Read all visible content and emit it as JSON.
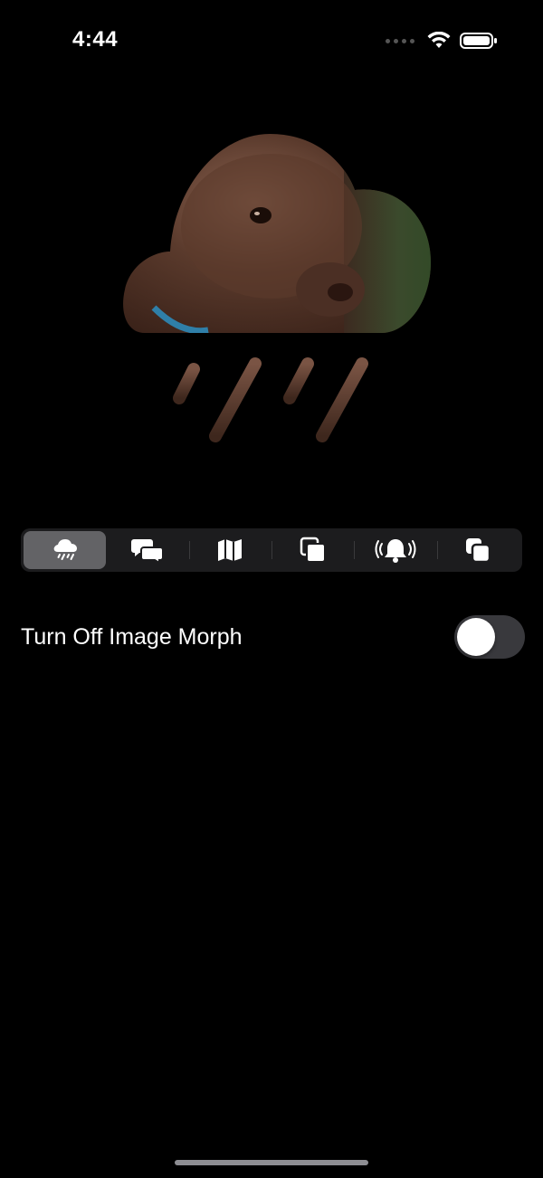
{
  "status_bar": {
    "time": "4:44"
  },
  "segments": [
    {
      "icon": "cloud-rain-icon",
      "selected": true
    },
    {
      "icon": "chat-bubbles-icon",
      "selected": false
    },
    {
      "icon": "map-icon",
      "selected": false
    },
    {
      "icon": "square-stack-icon",
      "selected": false
    },
    {
      "icon": "bell-ringing-icon",
      "selected": false
    },
    {
      "icon": "square-on-square-icon",
      "selected": false
    }
  ],
  "settings": {
    "morph_label": "Turn Off Image Morph",
    "morph_enabled": false
  },
  "colors": {
    "accent": "#636366",
    "background": "#000000"
  }
}
